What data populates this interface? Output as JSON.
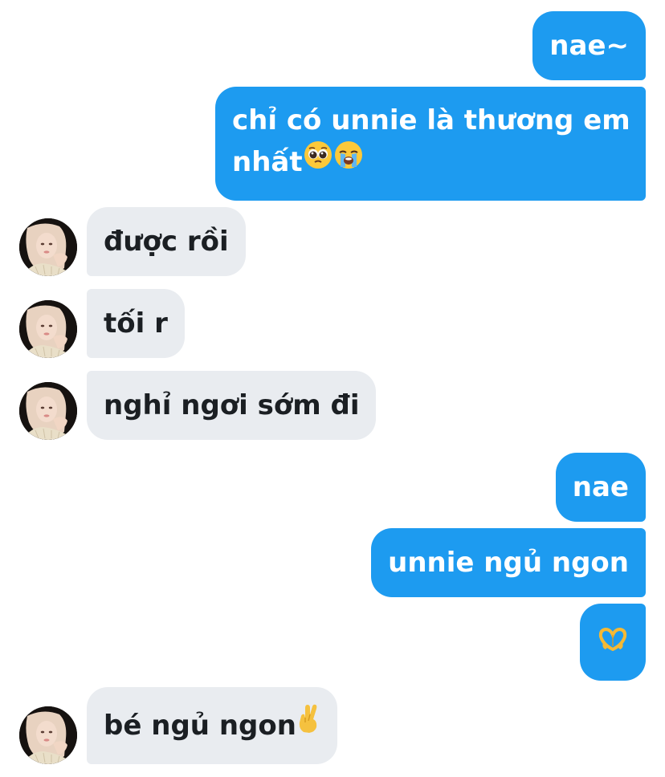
{
  "conversation": {
    "messages": [
      {
        "sender": "me",
        "text": "nae~"
      },
      {
        "sender": "me",
        "text": "chỉ có unnie là thương em",
        "text_line2": "nhất",
        "emojis": [
          "pleading-face",
          "loudly-crying-face"
        ]
      },
      {
        "sender": "them",
        "text": "được rồi"
      },
      {
        "sender": "them",
        "text": "tối r"
      },
      {
        "sender": "them",
        "text": "nghỉ ngơi sớm đi"
      },
      {
        "sender": "me",
        "text": "nae"
      },
      {
        "sender": "me",
        "text": "unnie ngủ ngon"
      },
      {
        "sender": "me",
        "text": "",
        "emojis": [
          "heart-hands"
        ]
      },
      {
        "sender": "them",
        "text": "bé ngủ ngon",
        "emojis": [
          "crossed-fingers"
        ]
      }
    ]
  },
  "colors": {
    "outgoing_bubble": "#1d9bf0",
    "incoming_bubble": "#e9ecf0",
    "outgoing_text": "#ffffff",
    "incoming_text": "#1b1f23"
  }
}
